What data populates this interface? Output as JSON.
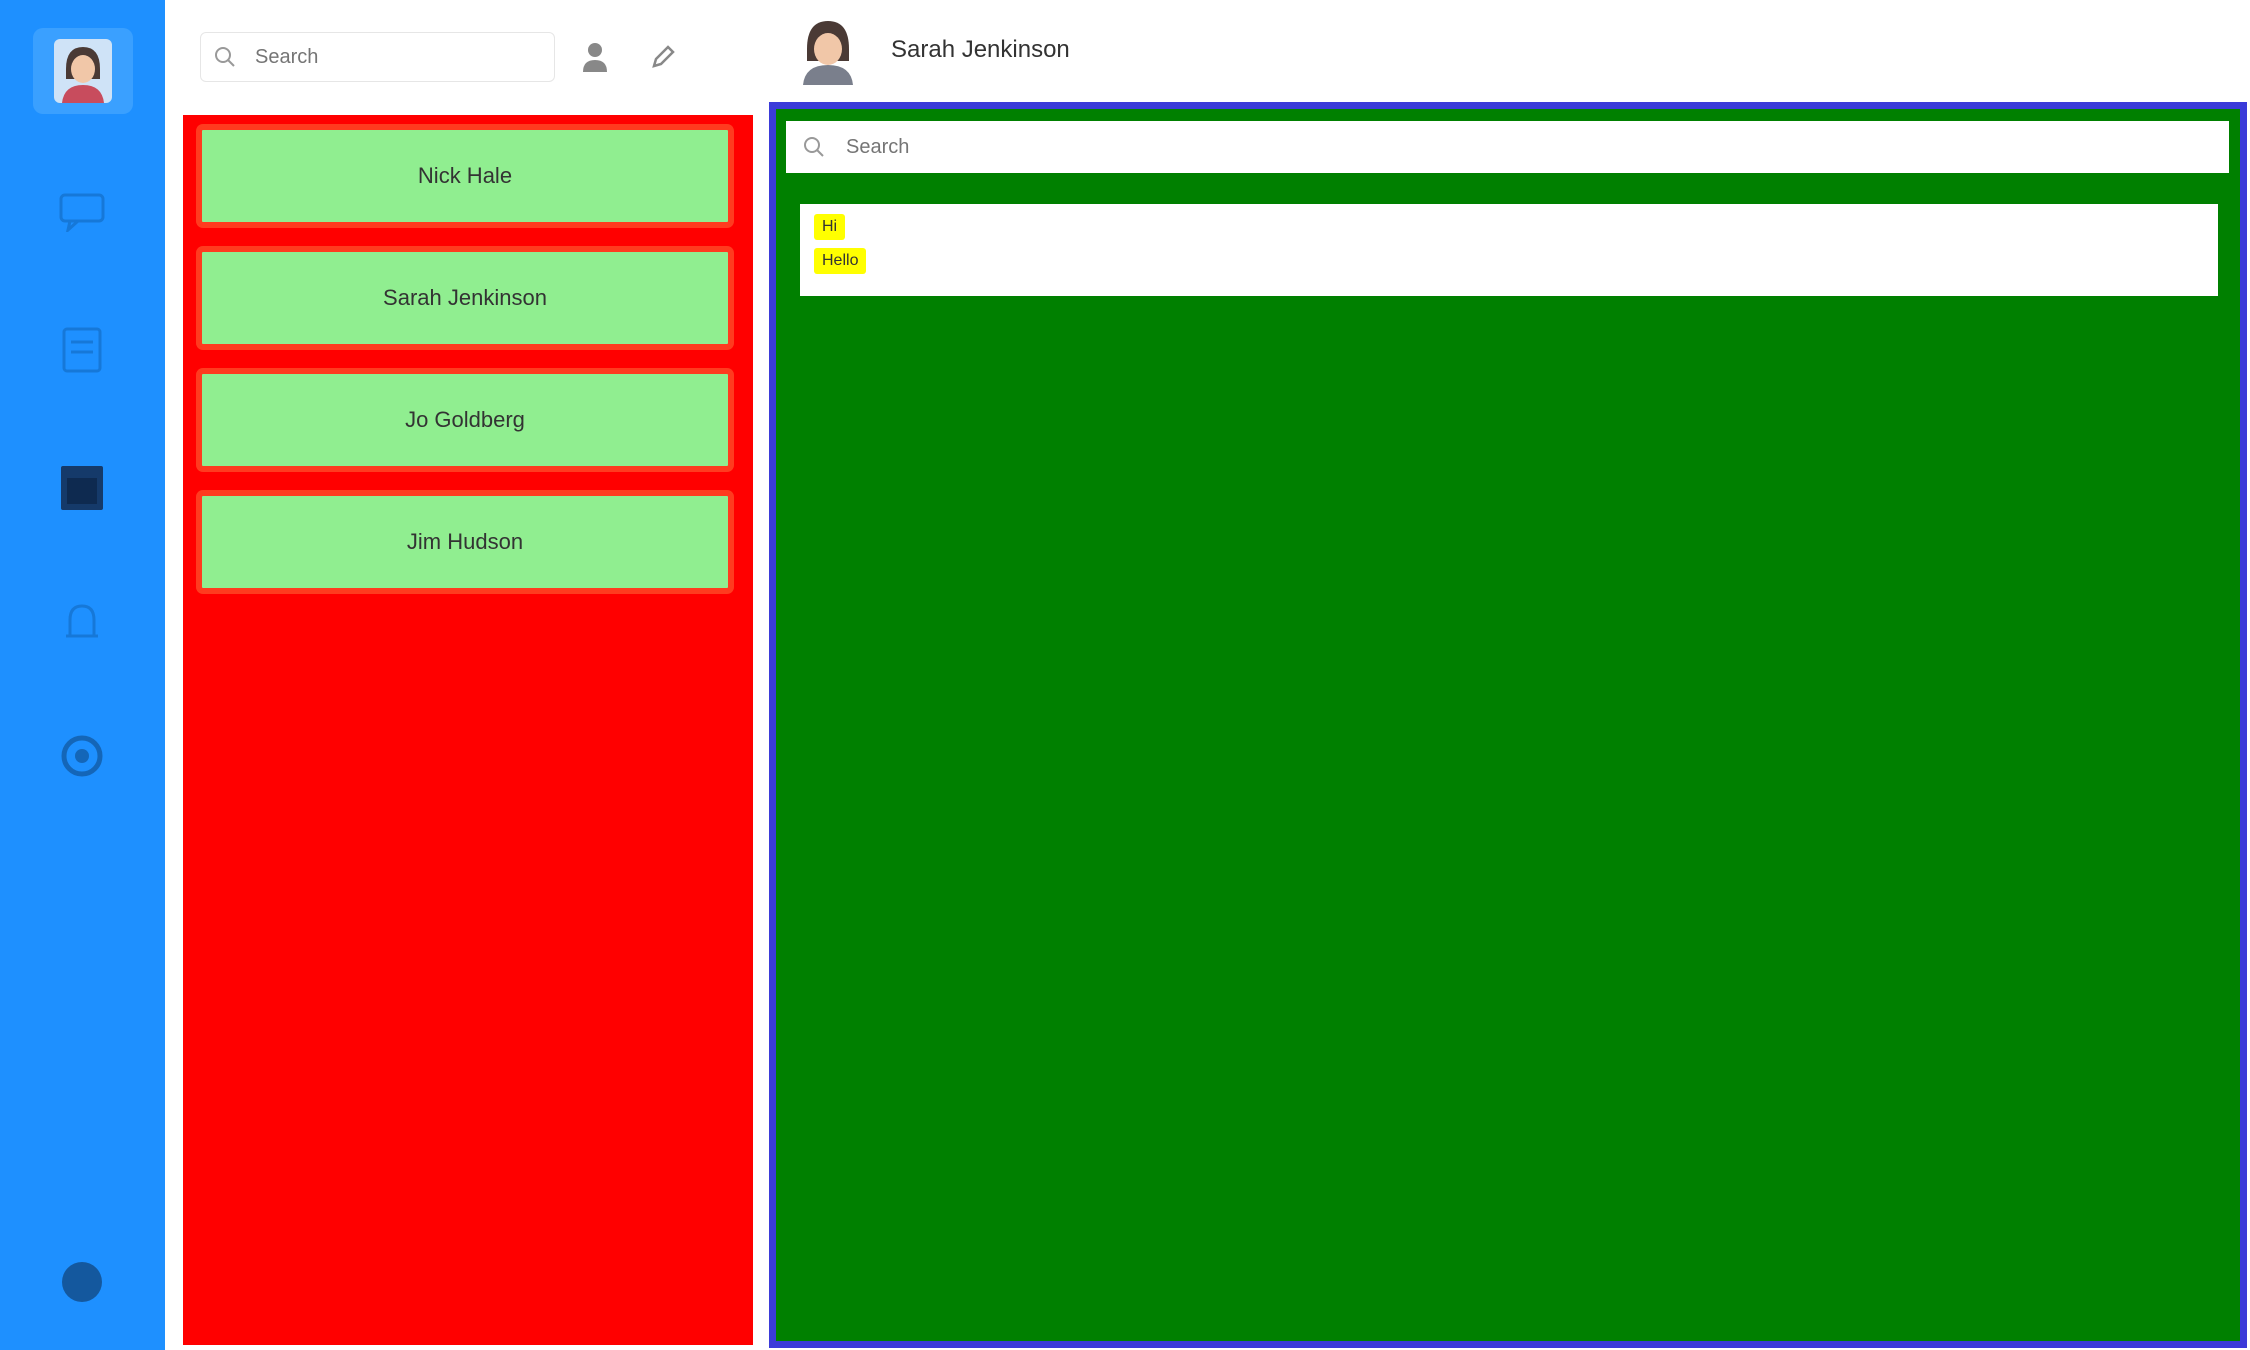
{
  "sidebar": {
    "nav": [
      {
        "icon": "chat-icon"
      },
      {
        "icon": "contacts-icon"
      },
      {
        "icon": "calendar-icon"
      },
      {
        "icon": "bell-icon"
      },
      {
        "icon": "settings-icon"
      }
    ],
    "bottom_icon": "logout-icon"
  },
  "chat_list": {
    "search_placeholder": "Search",
    "items": [
      {
        "label": "Nick Hale"
      },
      {
        "label": "Sarah Jenkinson"
      },
      {
        "label": "Jo Goldberg"
      },
      {
        "label": "Jim Hudson"
      }
    ]
  },
  "conversation": {
    "contact_name": "Sarah Jenkinson",
    "search_placeholder": "Search",
    "messages": [
      {
        "text": "Hi"
      },
      {
        "text": "Hello"
      }
    ]
  },
  "colors": {
    "rail": "#1e90ff",
    "chat_list_bg": "#ff0000",
    "chat_item_bg": "#90ee90",
    "chat_panel_bg": "#008000",
    "chat_panel_border": "#3b3bd9",
    "message_tag": "#ffff00"
  }
}
